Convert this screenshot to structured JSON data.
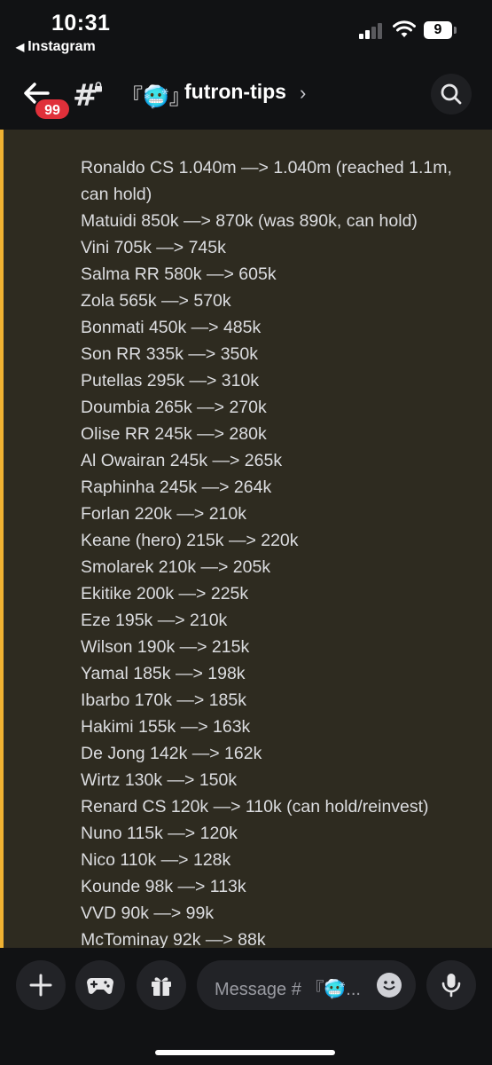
{
  "status_bar": {
    "time": "10:31",
    "back_app_label": "Instagram",
    "battery_level": "9"
  },
  "header": {
    "notification_count": "99",
    "channel_emoji": "『🥶』",
    "channel_name": "futron-tips"
  },
  "messages": [
    "Ronaldo CS 1.040m —> 1.040m (reached 1.1m, can hold)",
    "Matuidi 850k —> 870k (was 890k, can hold)",
    "Vini 705k —> 745k",
    "Salma RR 580k —> 605k",
    "Zola 565k —> 570k",
    "Bonmati 450k —> 485k",
    "Son RR 335k —> 350k",
    "Putellas 295k —> 310k",
    "Doumbia 265k —> 270k",
    "Olise RR 245k —> 280k",
    "Al Owairan 245k —> 265k",
    "Raphinha 245k —> 264k",
    "Forlan 220k —> 210k",
    "Keane (hero) 215k —> 220k",
    "Smolarek 210k —> 205k",
    "Ekitike 200k —> 225k",
    "Eze 195k —> 210k",
    "Wilson 190k —> 215k",
    "Yamal 185k —> 198k",
    "Ibarbo 170k —> 185k",
    "Hakimi 155k —> 163k",
    "De Jong 142k —> 162k",
    "Wirtz 130k —> 150k",
    "Renard CS 120k —> 110k (can hold/reinvest)",
    "Nuno 115k —> 120k",
    "Nico 110k —> 128k",
    "Kounde 98k —> 113k",
    "VVD 90k —> 99k",
    "McTominay 92k —> 88k"
  ],
  "composer": {
    "placeholder": "Message # 『🥶..."
  },
  "colors": {
    "accent_bar": "#f0b232",
    "highlight_bg": "#2e2b20",
    "badge": "#e0303a"
  },
  "icons": [
    "back-arrow-icon",
    "hash-icon",
    "lock-icon",
    "chevron-right-icon",
    "search-icon",
    "plus-icon",
    "gamepad-icon",
    "gift-icon",
    "emoji-icon",
    "microphone-icon"
  ]
}
